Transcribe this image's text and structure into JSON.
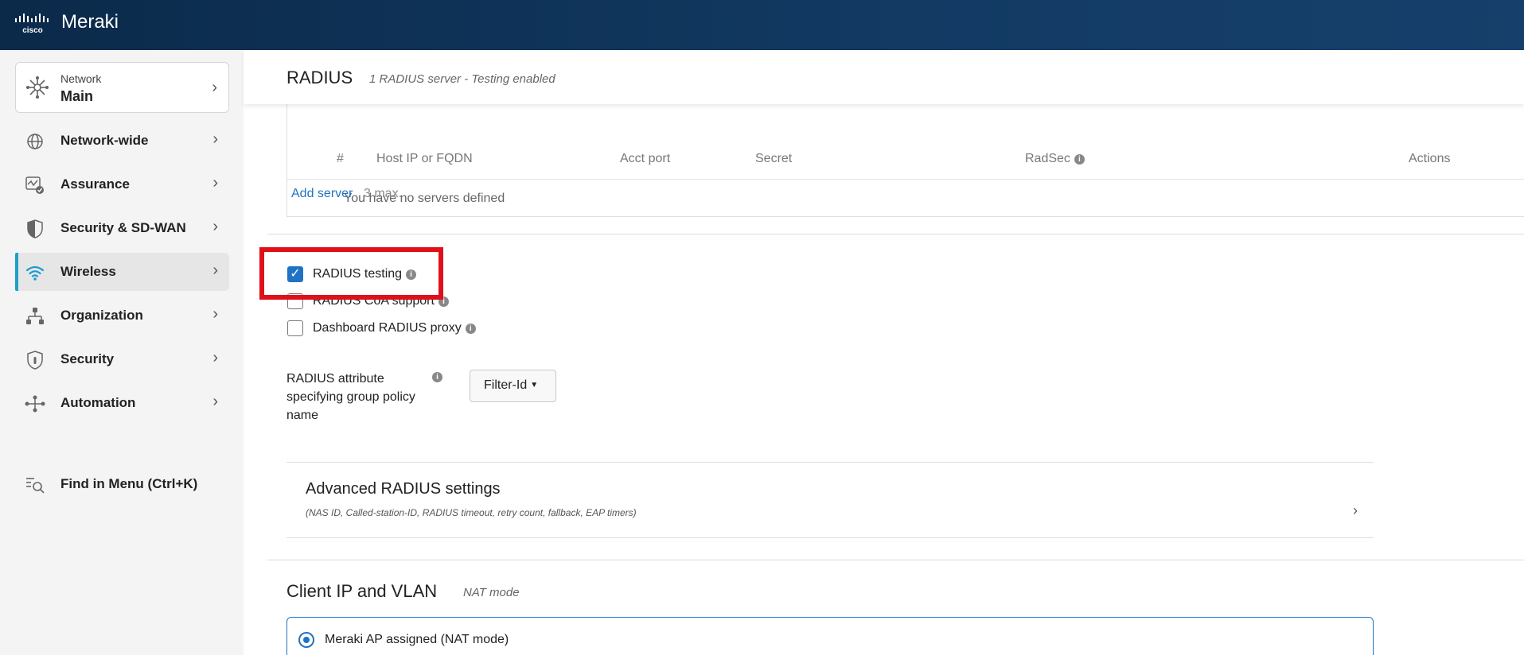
{
  "brand": {
    "name": "Meraki",
    "logo_text": "cisco"
  },
  "sidebar": {
    "network": {
      "small_label": "Network",
      "name": "Main"
    },
    "items": [
      {
        "label": "Network-wide",
        "icon": "network-wide-icon"
      },
      {
        "label": "Assurance",
        "icon": "assurance-icon"
      },
      {
        "label": "Security & SD-WAN",
        "icon": "shield-half-icon"
      },
      {
        "label": "Wireless",
        "icon": "wifi-icon",
        "active": true
      },
      {
        "label": "Organization",
        "icon": "organization-icon"
      },
      {
        "label": "Security",
        "icon": "security-shield-icon"
      },
      {
        "label": "Automation",
        "icon": "automation-icon"
      }
    ],
    "find": {
      "label": "Find in Menu (Ctrl+K)",
      "icon": "find-menu-icon"
    }
  },
  "radius": {
    "title": "RADIUS",
    "subtitle": "1 RADIUS server - Testing enabled",
    "columns": [
      "#",
      "Host IP or FQDN",
      "Acct port",
      "Secret",
      "RadSec",
      "Actions"
    ],
    "empty_text": "You have no servers defined",
    "add_server": "Add server",
    "max_text": "3 max.",
    "options": [
      {
        "label": "RADIUS testing",
        "checked": true
      },
      {
        "label": "RADIUS CoA support",
        "checked": false
      },
      {
        "label": "Dashboard RADIUS proxy",
        "checked": false
      }
    ],
    "attribute_label": "RADIUS attribute specifying group policy name",
    "attribute_value": "Filter-Id"
  },
  "advanced": {
    "title": "Advanced RADIUS settings",
    "subtitle": "(NAS ID, Called-station-ID, RADIUS timeout, retry count, fallback, EAP timers)"
  },
  "client": {
    "title": "Client IP and VLAN",
    "subtitle": "NAT mode",
    "option_label": "Meraki AP assigned (NAT mode)"
  },
  "colors": {
    "accent": "#1f73c5",
    "highlight_box": "#e0101a",
    "topbar": "#0b2a4a",
    "active_bar": "#20a0c8"
  }
}
